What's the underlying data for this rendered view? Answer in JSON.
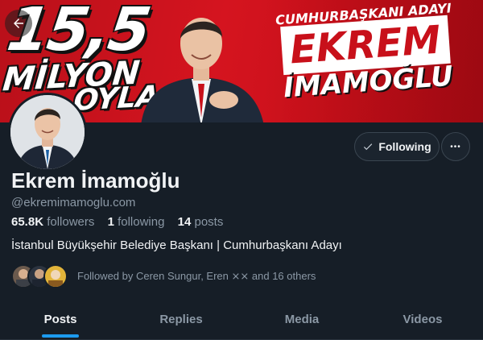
{
  "banner": {
    "big_number": "15,5",
    "line_milyon": "MİLYON",
    "line_oyla": "OYLA",
    "subtitle": "CUMHURBAŞKANI ADAYI",
    "name_first": "EKREM",
    "name_last": "İMAMOĞLU"
  },
  "profile": {
    "display_name": "Ekrem İmamoğlu",
    "handle": "@ekremimamoglu.com",
    "followers_count": "65.8K",
    "followers_label": "followers",
    "following_count": "1",
    "following_label": "following",
    "posts_count": "14",
    "posts_label": "posts",
    "bio": "İstanbul Büyükşehir Belediye Başkanı | Cumhurbaşkanı Adayı",
    "followed_by": "Followed by Ceren Sungur, Eren ⨯⨯ and 16 others"
  },
  "actions": {
    "following_label": "Following",
    "more_label": "•••"
  },
  "tabs": [
    {
      "label": "Posts"
    },
    {
      "label": "Replies"
    },
    {
      "label": "Media"
    },
    {
      "label": "Videos"
    }
  ],
  "colors": {
    "accent": "#1d9bf0",
    "background": "#161e27",
    "banner_red": "#d5141f"
  },
  "icons": {
    "back": "arrow-left-icon",
    "following_check": "check-icon",
    "more": "ellipsis-icon"
  }
}
